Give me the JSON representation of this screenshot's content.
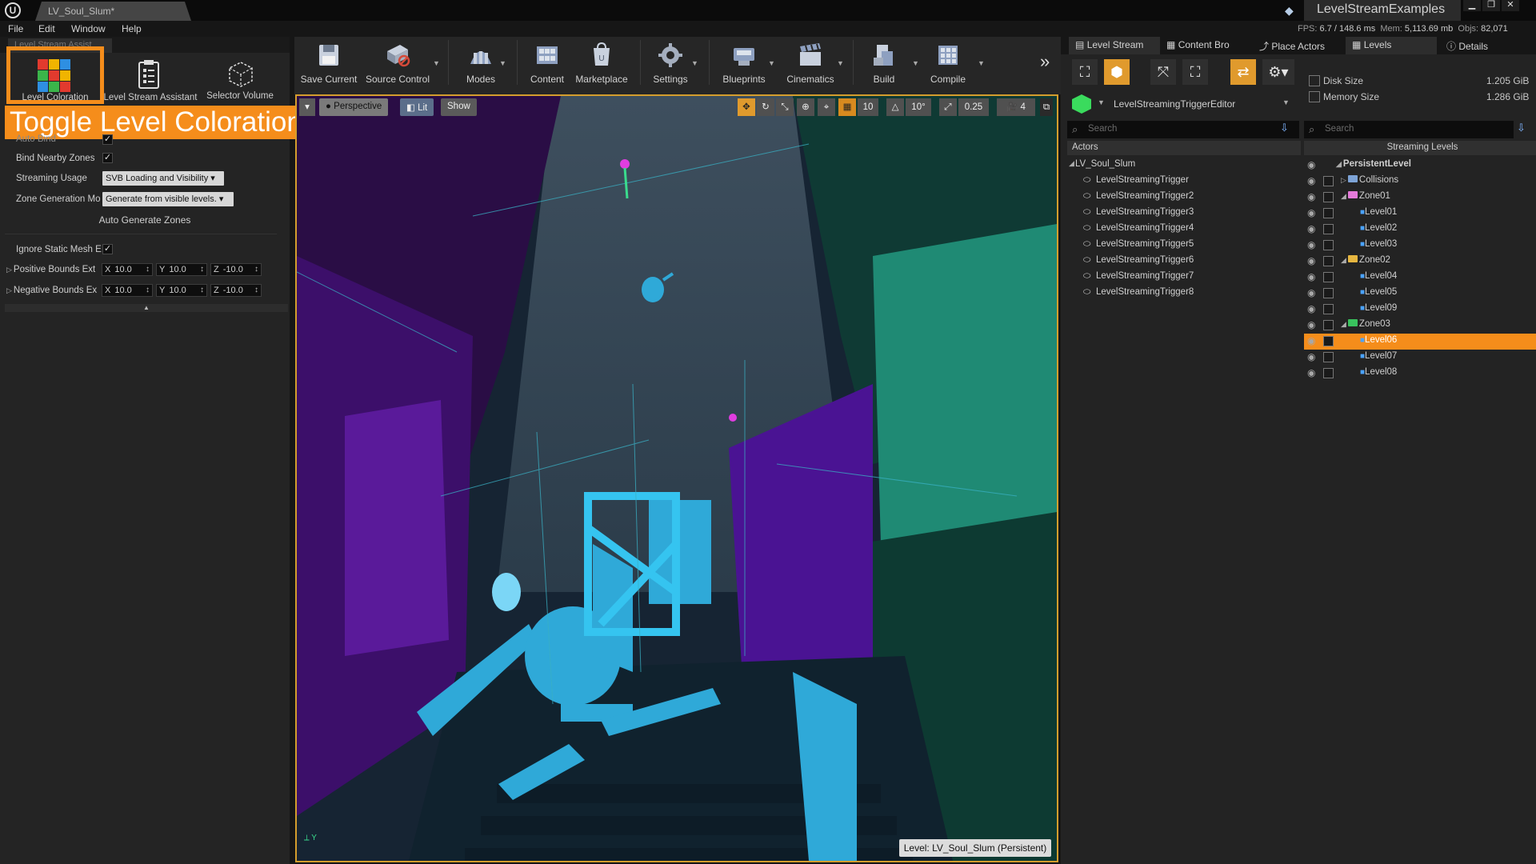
{
  "titlebar": {
    "doc_tab": "LV_Soul_Slum*",
    "project": "LevelStreamExamples",
    "logo": "U",
    "window_buttons": [
      "▁",
      "❐",
      "✕"
    ]
  },
  "menu": [
    "File",
    "Edit",
    "Window",
    "Help"
  ],
  "stats": {
    "fps_label": "FPS:",
    "fps": "6.7",
    "ms": "/ 148.6 ms",
    "mem_label": "Mem:",
    "mem": "5,113.69 mb",
    "objs_label": "Objs:",
    "objs": "82,071"
  },
  "left_panel": {
    "tab": "Level Stream Assist",
    "tools": [
      "Level Coloration",
      "Level Stream Assistant",
      "Selector Volume"
    ],
    "callout": "Toggle Level Coloration",
    "props": {
      "auto_bind": "Auto Bind",
      "bind_nearby": "Bind Nearby Zones",
      "streaming_usage": "Streaming Usage",
      "streaming_usage_value": "SVB Loading and Visibility",
      "zone_gen": "Zone Generation Mo",
      "zone_gen_value": "Generate from visible levels.",
      "auto_generate": "Auto Generate Zones",
      "ignore_static": "Ignore Static Mesh E",
      "pos_bounds": "Positive Bounds Ext",
      "neg_bounds": "Negative Bounds Ex",
      "x": "X",
      "y": "Y",
      "z": "Z",
      "pos_x": "10.0",
      "pos_y": "10.0",
      "pos_z": "-10.0",
      "neg_x": "10.0",
      "neg_y": "10.0",
      "neg_z": "-10.0"
    }
  },
  "toolbar": {
    "items": [
      "Save Current",
      "Source Control",
      "Modes",
      "Content",
      "Marketplace",
      "Settings",
      "Blueprints",
      "Cinematics",
      "Build",
      "Compile"
    ],
    "more": "»"
  },
  "viewport": {
    "perspective": "Perspective",
    "lit": "Lit",
    "show": "Show",
    "grid_snap": "10",
    "rot_snap": "10°",
    "scale_snap": "0.25",
    "cam_speed": "4",
    "level_label": "Level:  LV_Soul_Slum (Persistent)",
    "axis_y": "Y"
  },
  "right_tabs": [
    "Level Stream",
    "Content Bro",
    "Place Actors",
    "Levels",
    "Details"
  ],
  "level_stream": {
    "asset": "LevelStreamingTriggerEditor",
    "search_placeholder": "Search",
    "actors_header": "Actors",
    "root": "LV_Soul_Slum",
    "actors": [
      "LevelStreamingTrigger",
      "LevelStreamingTrigger2",
      "LevelStreamingTrigger3",
      "LevelStreamingTrigger4",
      "LevelStreamingTrigger5",
      "LevelStreamingTrigger6",
      "LevelStreamingTrigger7",
      "LevelStreamingTrigger8"
    ]
  },
  "levels": {
    "disk_size_label": "Disk Size",
    "disk_size": "1.205 GiB",
    "memory_size_label": "Memory Size",
    "memory_size": "1.286 GiB",
    "search_placeholder": "Search",
    "header": "Streaming Levels",
    "persistent": "PersistentLevel",
    "rows": [
      {
        "name": "Collisions",
        "kind": "folder",
        "color": "#7da3d6",
        "indent": 1,
        "collapsed": true
      },
      {
        "name": "Zone01",
        "kind": "folder",
        "color": "#e47ad9",
        "indent": 1
      },
      {
        "name": "Level01",
        "kind": "level",
        "indent": 2
      },
      {
        "name": "Level02",
        "kind": "level",
        "indent": 2
      },
      {
        "name": "Level03",
        "kind": "level",
        "indent": 2
      },
      {
        "name": "Zone02",
        "kind": "folder",
        "color": "#e6b640",
        "indent": 1
      },
      {
        "name": "Level04",
        "kind": "level",
        "indent": 2
      },
      {
        "name": "Level05",
        "kind": "level",
        "indent": 2
      },
      {
        "name": "Level09",
        "kind": "level",
        "indent": 2
      },
      {
        "name": "Zone03",
        "kind": "folder",
        "color": "#39c25d",
        "indent": 1
      },
      {
        "name": "Level06",
        "kind": "level",
        "indent": 2,
        "selected": true
      },
      {
        "name": "Level07",
        "kind": "level",
        "indent": 2
      },
      {
        "name": "Level08",
        "kind": "level",
        "indent": 2
      }
    ]
  },
  "colors": {
    "accent": "#f58d1b",
    "viewport_border": "#d49d2d",
    "selected_row": "#f58d1b"
  }
}
